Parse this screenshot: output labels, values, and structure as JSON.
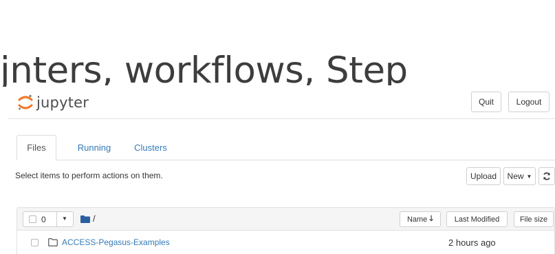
{
  "slide": {
    "heading_text": "jnters, workflows, Step"
  },
  "header": {
    "app_name": "jupyter",
    "quit_label": "Quit",
    "logout_label": "Logout"
  },
  "tabs": [
    {
      "label": "Files",
      "active": true
    },
    {
      "label": "Running",
      "active": false
    },
    {
      "label": "Clusters",
      "active": false
    }
  ],
  "toolbar": {
    "instructions": "Select items to perform actions on them.",
    "upload_label": "Upload",
    "new_label": "New",
    "refresh_icon": "refresh-icon"
  },
  "list_header": {
    "selected_count": "0",
    "path": "/",
    "sort_name_label": "Name",
    "sort_modified_label": "Last Modified",
    "sort_size_label": "File size"
  },
  "files": [
    {
      "name": "ACCESS-Pegasus-Examples",
      "type": "folder",
      "modified": "2 hours ago"
    }
  ],
  "colors": {
    "link": "#337ab7",
    "jupyter_orange": "#f37726",
    "folder_icon": "#2a5f9e",
    "header_bg": "#f5f5f5"
  }
}
